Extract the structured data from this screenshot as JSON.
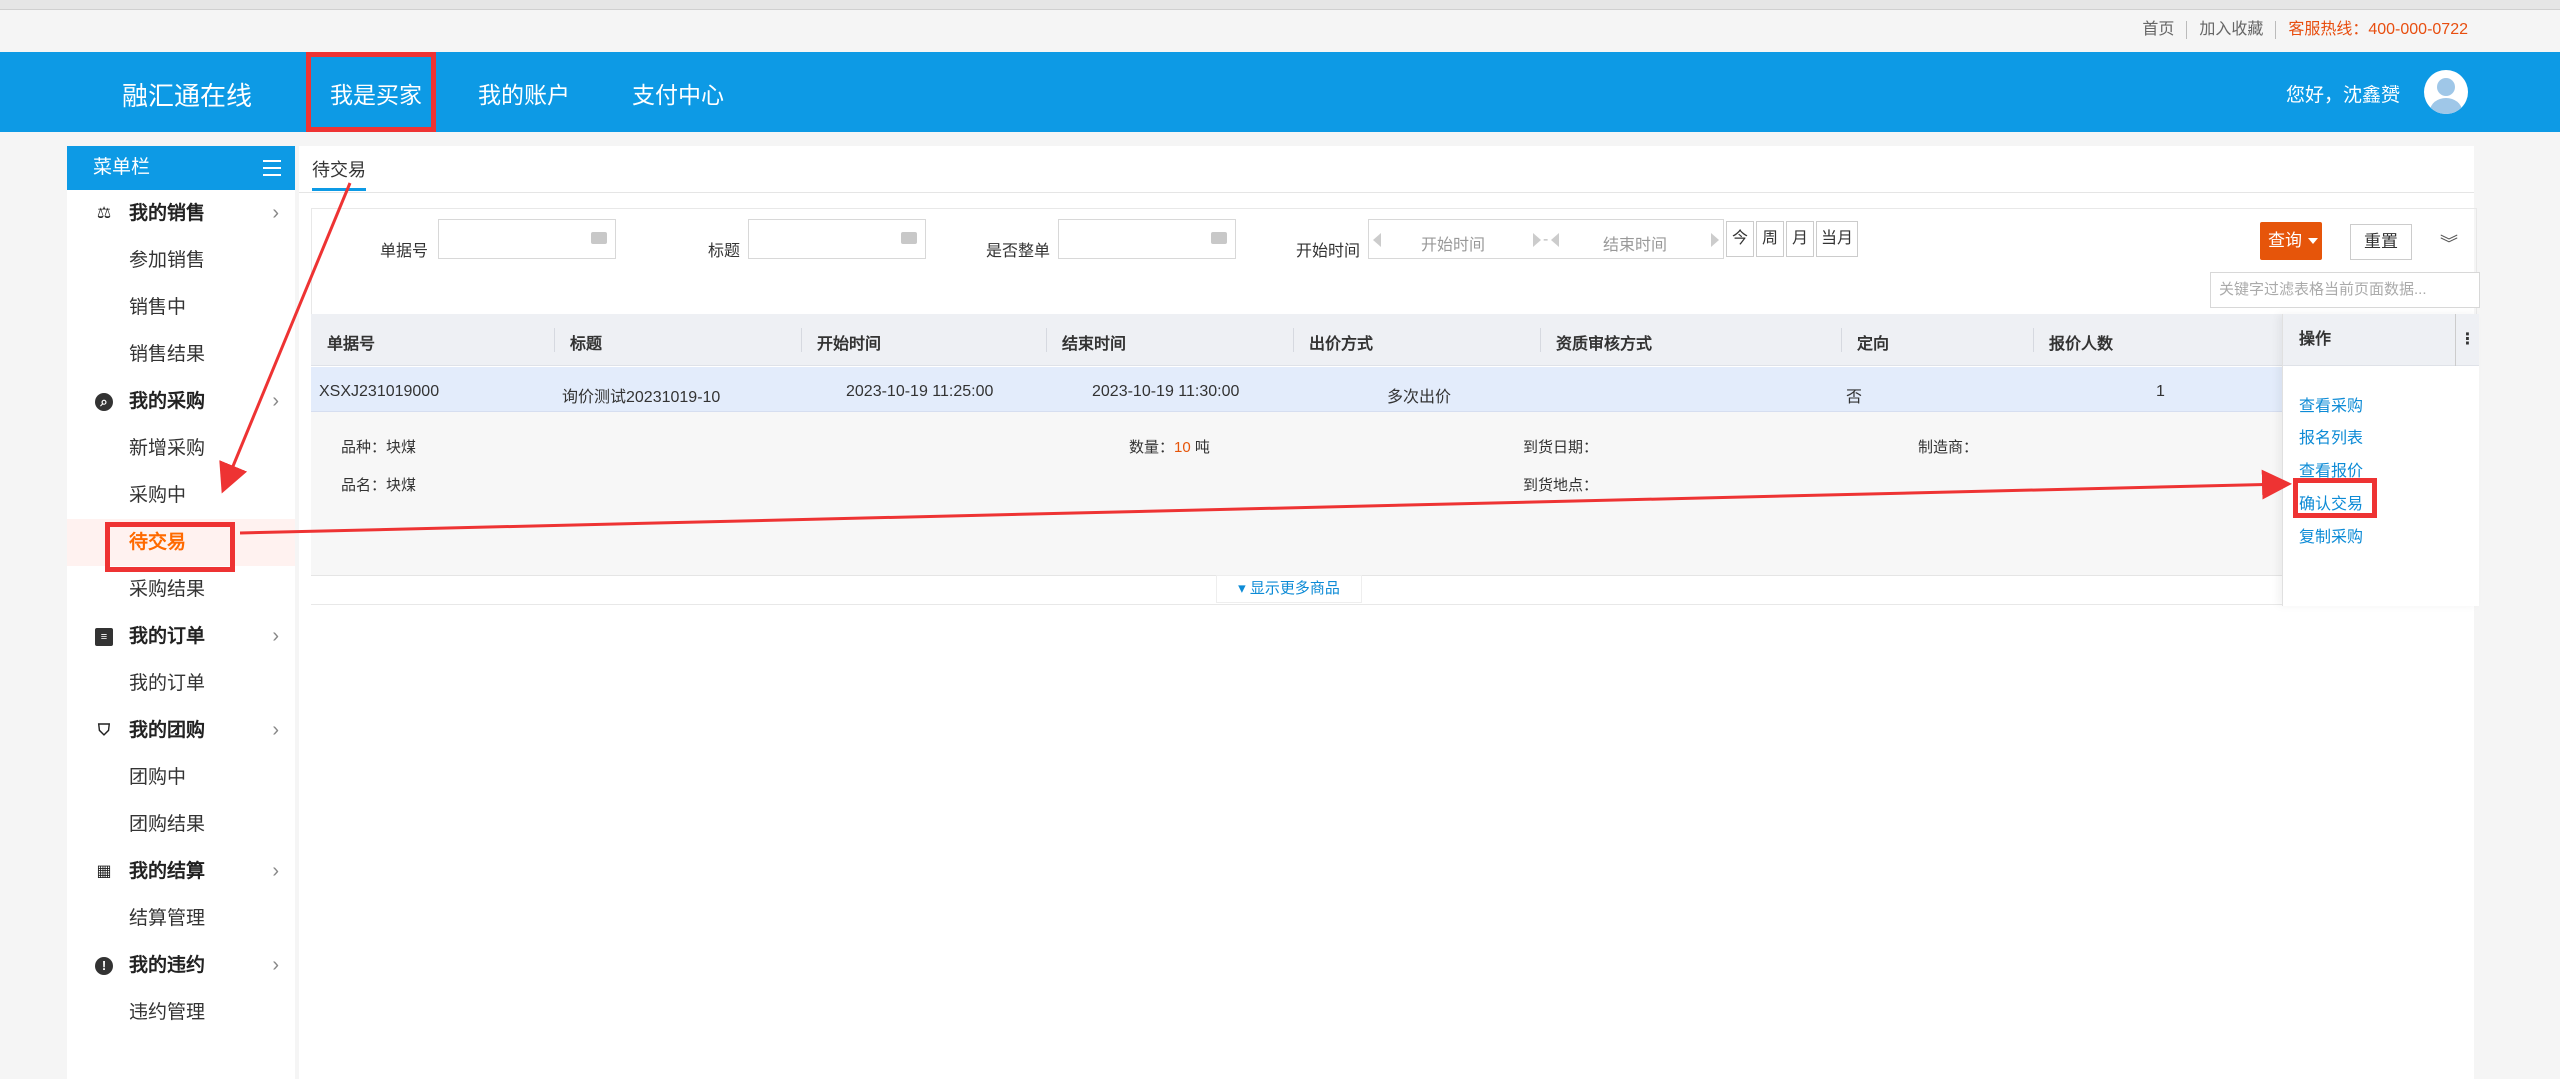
{
  "util_links": [
    "首页",
    "加入收藏",
    "客服热线：400-000-0722"
  ],
  "nav": {
    "brand": "融汇通在线",
    "items": [
      "我是买家",
      "我的账户",
      "支付中心"
    ],
    "greeting": "您好，沈鑫赟"
  },
  "sidebar": {
    "title": "菜单栏",
    "groups": [
      {
        "label": "我的销售",
        "icon": "gavel-icon",
        "items": [
          "参加销售",
          "销售中",
          "销售结果"
        ]
      },
      {
        "label": "我的采购",
        "icon": "search-circle-icon",
        "items": [
          "新增采购",
          "采购中",
          "待交易",
          "采购结果"
        ]
      },
      {
        "label": "我的订单",
        "icon": "document-icon",
        "items": [
          "我的订单"
        ]
      },
      {
        "label": "我的团购",
        "icon": "bag-icon",
        "items": [
          "团购中",
          "团购结果"
        ]
      },
      {
        "label": "我的结算",
        "icon": "calculator-icon",
        "items": [
          "结算管理"
        ]
      },
      {
        "label": "我的违约",
        "icon": "exclamation-icon",
        "items": [
          "违约管理"
        ]
      }
    ],
    "active_item": "待交易"
  },
  "tab": "待交易",
  "filter": {
    "labels": [
      "单据号",
      "标题",
      "是否整单",
      "开始时间"
    ],
    "start_placeholder": "开始时间",
    "end_placeholder": "结束时间",
    "quick": [
      "今",
      "周",
      "月",
      "当月"
    ],
    "query": "查询",
    "reset": "重置",
    "keyword_placeholder": "关键字过滤表格当前页面数据..."
  },
  "table": {
    "headers": [
      "单据号",
      "标题",
      "开始时间",
      "结束时间",
      "出价方式",
      "资质审核方式",
      "定向",
      "报价人数",
      "操作"
    ],
    "row": {
      "no": "XSXJ231019000",
      "title": "询价测试20231019-10",
      "start": "2023-10-19 11:25:00",
      "end": "2023-10-19 11:30:00",
      "bid": "多次出价",
      "audit": "",
      "directed": "否",
      "count": "1"
    },
    "detail": {
      "variety_label": "品种：",
      "variety": "块煤",
      "name_label": "品名：",
      "name": "块煤",
      "qty_label": "数量：",
      "qty": "10",
      "qty_unit": "吨",
      "date_label": "到货日期：",
      "place_label": "到货地点：",
      "maker_label": "制造商："
    },
    "more": "显示更多商品",
    "ops": [
      "查看采购",
      "报名列表",
      "查看报价",
      "确认交易",
      "复制采购"
    ]
  }
}
